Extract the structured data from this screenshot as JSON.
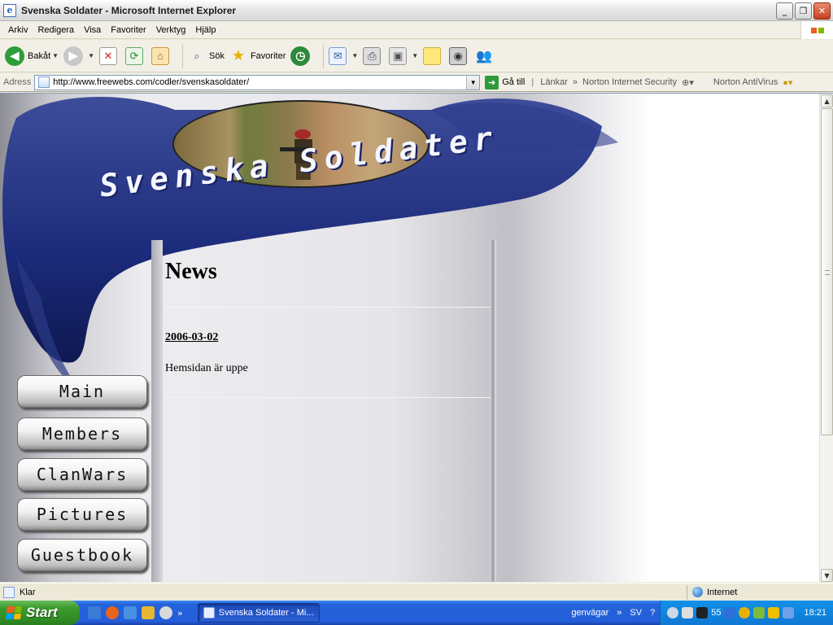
{
  "window": {
    "title": "Svenska Soldater - Microsoft Internet Explorer"
  },
  "menu": [
    "Arkiv",
    "Redigera",
    "Visa",
    "Favoriter",
    "Verktyg",
    "Hjälp"
  ],
  "toolbar": {
    "back_label": "Bakåt",
    "search_label": "Sök",
    "favorites_label": "Favoriter"
  },
  "address": {
    "label": "Adress",
    "url": "http://www.freewebs.com/codler/svenskasoldater/",
    "go_label": "Gå till",
    "links_label": "Länkar",
    "norton_security": "Norton Internet Security",
    "norton_antivirus": "Norton AntiVirus"
  },
  "site": {
    "banner_title": "Svenska Soldater",
    "nav": [
      "Main",
      "Members",
      "ClanWars",
      "Pictures",
      "Guestbook"
    ],
    "news_title": "News",
    "news_date": "2006-03-02",
    "news_body": "Hemsidan är uppe"
  },
  "status": {
    "text": "Klar",
    "zone": "Internet"
  },
  "taskbar": {
    "start_label": "Start",
    "task_label": "Svenska Soldater - Mi...",
    "toolbar_label": "genvägar",
    "lang": "SV",
    "tray_number": "55",
    "clock": "18:21"
  },
  "colors": {
    "taskbar_blue": "#245edb",
    "start_green": "#3c9a2e",
    "banner_blue": "#1b2a7a"
  }
}
